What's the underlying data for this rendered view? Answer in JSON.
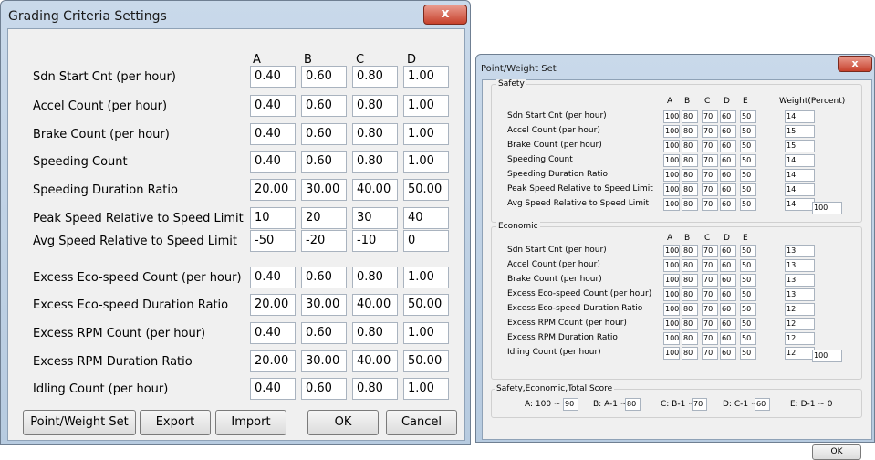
{
  "grading": {
    "title": "Grading Criteria Settings",
    "close": "x",
    "columns": [
      "A",
      "B",
      "C",
      "D"
    ],
    "rows": [
      {
        "label": "Sdn Start Cnt (per hour)",
        "values": [
          "0.40",
          "0.60",
          "0.80",
          "1.00"
        ]
      },
      {
        "label": "Accel Count (per hour)",
        "values": [
          "0.40",
          "0.60",
          "0.80",
          "1.00"
        ]
      },
      {
        "label": "Brake Count (per hour)",
        "values": [
          "0.40",
          "0.60",
          "0.80",
          "1.00"
        ]
      },
      {
        "label": "Speeding Count",
        "values": [
          "0.40",
          "0.60",
          "0.80",
          "1.00"
        ]
      },
      {
        "label": "Speeding Duration Ratio",
        "values": [
          "20.00",
          "30.00",
          "40.00",
          "50.00"
        ]
      },
      {
        "label": "Peak Speed Relative to Speed Limit",
        "values": [
          "10",
          "20",
          "30",
          "40"
        ]
      },
      {
        "label": "Avg Speed Relative to Speed Limit",
        "values": [
          "-50",
          "-20",
          "-10",
          "0"
        ]
      },
      {
        "label": "Excess Eco-speed Count (per hour)",
        "values": [
          "0.40",
          "0.60",
          "0.80",
          "1.00"
        ]
      },
      {
        "label": "Excess Eco-speed Duration Ratio",
        "values": [
          "20.00",
          "30.00",
          "40.00",
          "50.00"
        ]
      },
      {
        "label": "Excess RPM Count (per hour)",
        "values": [
          "0.40",
          "0.60",
          "0.80",
          "1.00"
        ]
      },
      {
        "label": "Excess RPM Duration Ratio",
        "values": [
          "20.00",
          "30.00",
          "40.00",
          "50.00"
        ]
      },
      {
        "label": "Idling Count (per hour)",
        "values": [
          "0.40",
          "0.60",
          "0.80",
          "1.00"
        ]
      }
    ],
    "buttons": {
      "point_weight": "Point/Weight Set",
      "export": "Export",
      "import": "Import",
      "ok": "OK",
      "cancel": "Cancel"
    }
  },
  "pointweight": {
    "title": "Point/Weight Set",
    "close": "x",
    "safety": {
      "title": "Safety",
      "columns": [
        "A",
        "B",
        "C",
        "D",
        "E"
      ],
      "weight_header": "Weight(Percent)",
      "rows": [
        {
          "label": "Sdn Start Cnt (per hour)",
          "values": [
            "100",
            "80",
            "70",
            "60",
            "50"
          ],
          "weight": "14"
        },
        {
          "label": "Accel Count (per hour)",
          "values": [
            "100",
            "80",
            "70",
            "60",
            "50"
          ],
          "weight": "15"
        },
        {
          "label": "Brake Count (per hour)",
          "values": [
            "100",
            "80",
            "70",
            "60",
            "50"
          ],
          "weight": "15"
        },
        {
          "label": "Speeding Count",
          "values": [
            "100",
            "80",
            "70",
            "60",
            "50"
          ],
          "weight": "14"
        },
        {
          "label": "Speeding Duration Ratio",
          "values": [
            "100",
            "80",
            "70",
            "60",
            "50"
          ],
          "weight": "14"
        },
        {
          "label": "Peak Speed Relative to Speed Limit",
          "values": [
            "100",
            "80",
            "70",
            "60",
            "50"
          ],
          "weight": "14"
        },
        {
          "label": "Avg Speed Relative to Speed Limit",
          "values": [
            "100",
            "80",
            "70",
            "60",
            "50"
          ],
          "weight": "14"
        }
      ],
      "total": "100"
    },
    "economic": {
      "title": "Economic",
      "columns": [
        "A",
        "B",
        "C",
        "D",
        "E"
      ],
      "rows": [
        {
          "label": "Sdn Start Cnt (per hour)",
          "values": [
            "100",
            "80",
            "70",
            "60",
            "50"
          ],
          "weight": "13"
        },
        {
          "label": "Accel Count (per hour)",
          "values": [
            "100",
            "80",
            "70",
            "60",
            "50"
          ],
          "weight": "13"
        },
        {
          "label": "Brake Count (per hour)",
          "values": [
            "100",
            "80",
            "70",
            "60",
            "50"
          ],
          "weight": "13"
        },
        {
          "label": "Excess Eco-speed Count (per hour)",
          "values": [
            "100",
            "80",
            "70",
            "60",
            "50"
          ],
          "weight": "13"
        },
        {
          "label": "Excess Eco-speed Duration Ratio",
          "values": [
            "100",
            "80",
            "70",
            "60",
            "50"
          ],
          "weight": "12"
        },
        {
          "label": "Excess RPM Count (per hour)",
          "values": [
            "100",
            "80",
            "70",
            "60",
            "50"
          ],
          "weight": "12"
        },
        {
          "label": "Excess RPM Duration Ratio",
          "values": [
            "100",
            "80",
            "70",
            "60",
            "50"
          ],
          "weight": "12"
        },
        {
          "label": "Idling Count (per hour)",
          "values": [
            "100",
            "80",
            "70",
            "60",
            "50"
          ],
          "weight": "12"
        }
      ],
      "total": "100"
    },
    "score": {
      "title": "Safety,Economic,Total Score",
      "a_label": "A: 100 ~",
      "a_val": "90",
      "b_label": "B: A-1 ~",
      "b_val": "80",
      "c_label": "C: B-1 ~",
      "c_val": "70",
      "d_label": "D: C-1 ~",
      "d_val": "60",
      "e_label": "E: D-1 ~ 0"
    },
    "ok": "OK"
  }
}
